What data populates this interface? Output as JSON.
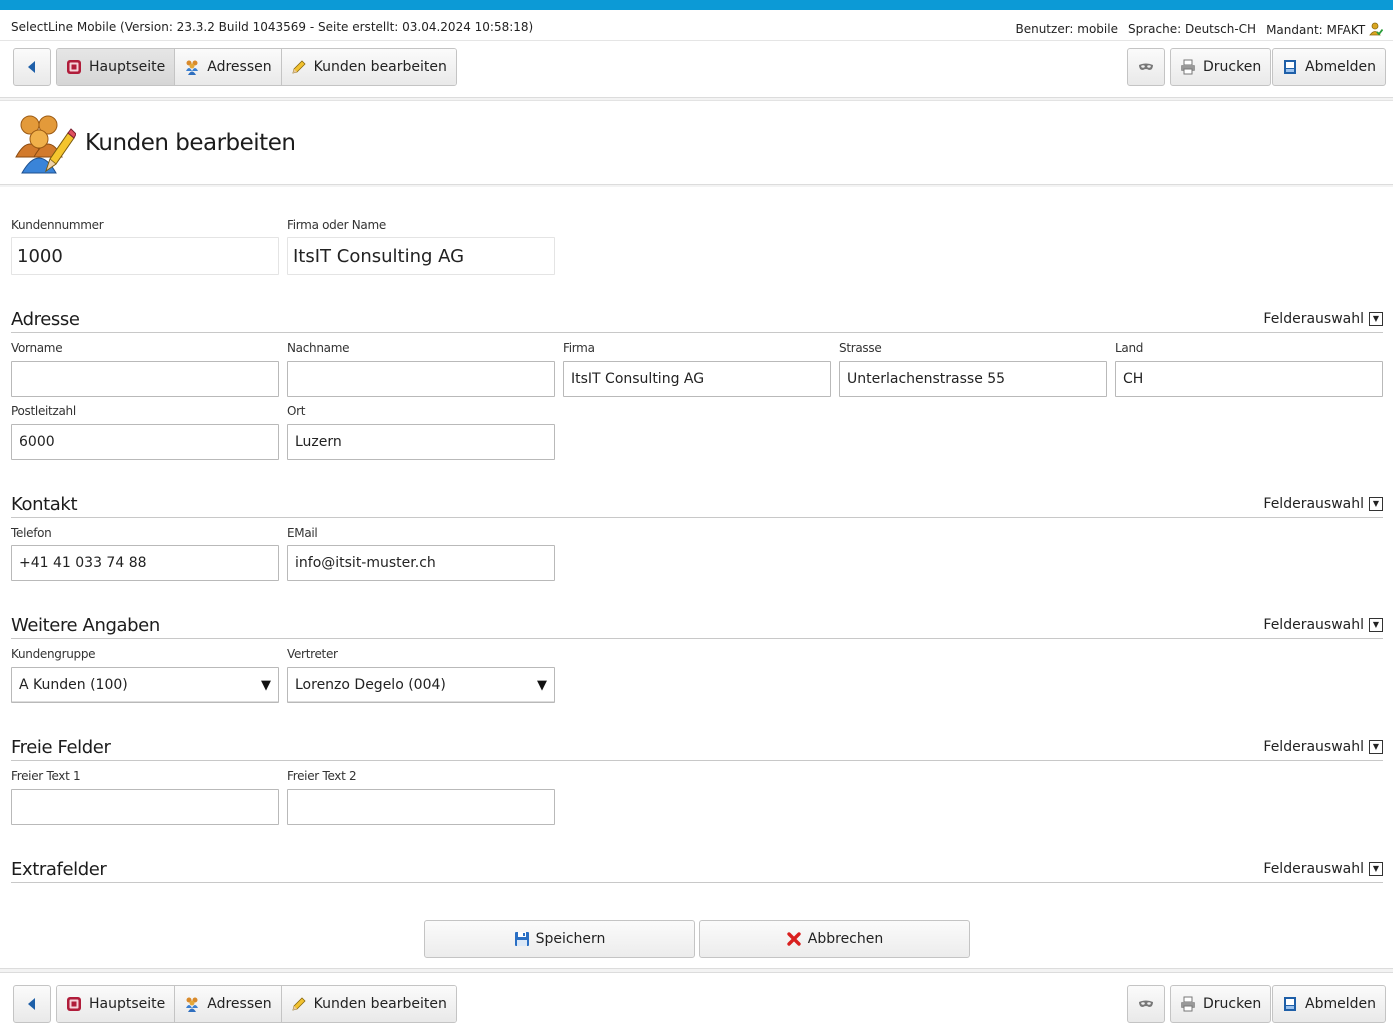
{
  "info": {
    "version_text": "SelectLine Mobile (Version: 23.3.2 Build 1043569 - Seite erstellt: 03.04.2024 10:58:18)",
    "benutzer": "Benutzer: mobile",
    "sprache": "Sprache: Deutsch-CH",
    "mandant": "Mandant: MFAKT"
  },
  "nav": {
    "hauptseite": "Hauptseite",
    "adressen": "Adressen",
    "kunden_bearbeiten": "Kunden bearbeiten",
    "drucken": "Drucken",
    "abmelden": "Abmelden"
  },
  "page_title": "Kunden bearbeiten",
  "fields": {
    "kundennummer": {
      "label": "Kundennummer",
      "value": "1000"
    },
    "firma_oder_name": {
      "label": "Firma oder Name",
      "value": "ItsIT Consulting AG"
    }
  },
  "felderauswahl": "Felderauswahl",
  "sections": {
    "adresse": {
      "title": "Adresse",
      "vorname": {
        "label": "Vorname",
        "value": ""
      },
      "nachname": {
        "label": "Nachname",
        "value": ""
      },
      "firma": {
        "label": "Firma",
        "value": "ItsIT Consulting AG"
      },
      "strasse": {
        "label": "Strasse",
        "value": "Unterlachenstrasse 55"
      },
      "land": {
        "label": "Land",
        "value": "CH"
      },
      "plz": {
        "label": "Postleitzahl",
        "value": "6000"
      },
      "ort": {
        "label": "Ort",
        "value": "Luzern"
      }
    },
    "kontakt": {
      "title": "Kontakt",
      "telefon": {
        "label": "Telefon",
        "value": "+41 41 033 74 88"
      },
      "email": {
        "label": "EMail",
        "value": "info@itsit-muster.ch"
      }
    },
    "weitere": {
      "title": "Weitere Angaben",
      "kundengruppe": {
        "label": "Kundengruppe",
        "value": "A Kunden (100)"
      },
      "vertreter": {
        "label": "Vertreter",
        "value": "Lorenzo Degelo (004)"
      }
    },
    "freie": {
      "title": "Freie Felder",
      "text1": {
        "label": "Freier Text 1",
        "value": ""
      },
      "text2": {
        "label": "Freier Text 2",
        "value": ""
      }
    },
    "extra": {
      "title": "Extrafelder"
    }
  },
  "actions": {
    "speichern": "Speichern",
    "abbrechen": "Abbrechen"
  },
  "colors": {
    "accent": "#0c9ad6",
    "cancel_red": "#d9201f",
    "save_blue": "#2a6fc4"
  }
}
